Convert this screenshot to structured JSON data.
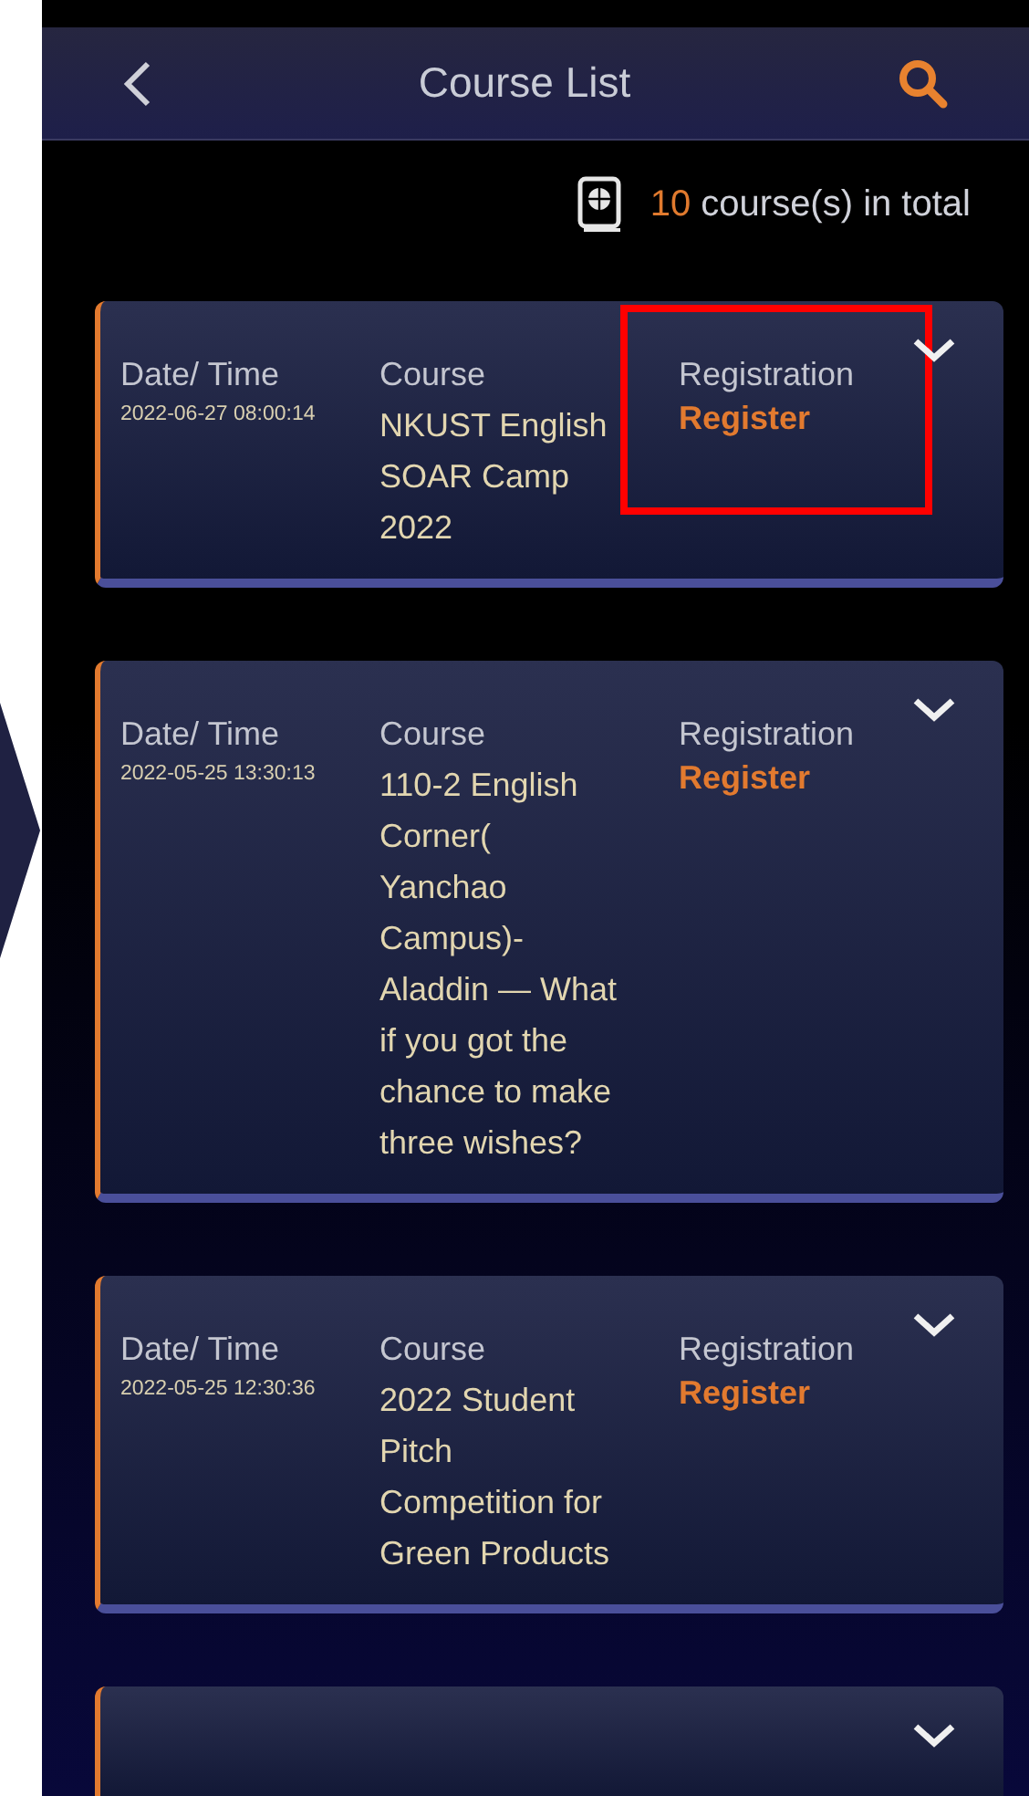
{
  "header": {
    "title": "Course List"
  },
  "summary": {
    "count": "10",
    "text": "course(s) in total"
  },
  "courses": [
    {
      "kind": "full",
      "highlighted": true,
      "date_label": "Date/ Time",
      "date": "2022-06-27 08:00:14",
      "course_label": "Course",
      "course": "NKUST English SOAR Camp 2022",
      "registration_label": "Registration",
      "action": "Register"
    },
    {
      "kind": "full",
      "highlighted": false,
      "date_label": "Date/ Time",
      "date": "2022-05-25 13:30:13",
      "course_label": "Course",
      "course": "110-2 English Corner( Yanchao Campus)- Aladdin — What if you got the chance to make three wishes?",
      "registration_label": "Registration",
      "action": "Register"
    },
    {
      "kind": "full",
      "highlighted": false,
      "date_label": "Date/ Time",
      "date": "2022-05-25 12:30:36",
      "course_label": "Course",
      "course": "2022 Student Pitch Competition for Green Products",
      "registration_label": "Registration",
      "action": "Register"
    },
    {
      "kind": "cut"
    }
  ]
}
